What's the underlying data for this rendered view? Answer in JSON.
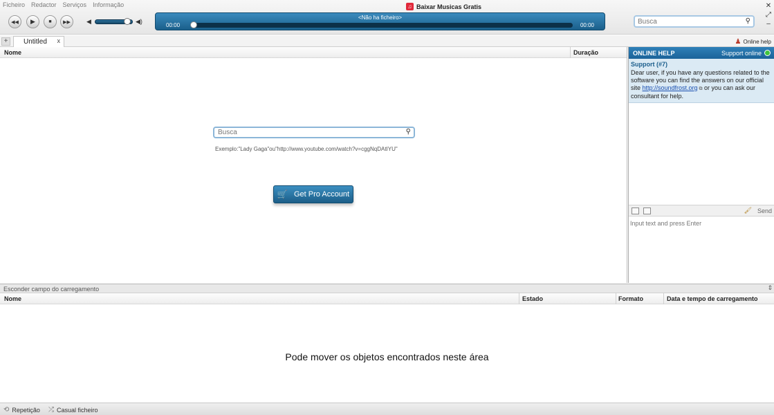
{
  "menu": [
    "Ficheiro",
    "Redactor",
    "Serviços",
    "Informação"
  ],
  "app_title": "Baixar Musicas Gratis",
  "player": {
    "track_title": "<Não ha ficheiro>",
    "time_elapsed": "00:00",
    "time_total": "00:00",
    "volume_level": 0.85,
    "progress": 0
  },
  "top_search": {
    "placeholder": "Busca"
  },
  "tabs": [
    {
      "label": "Untitled",
      "close": "x"
    }
  ],
  "online_help_link": "Online help",
  "main_list": {
    "columns": [
      "Nome",
      "Duração"
    ],
    "search_placeholder": "Busca",
    "example": "Exemplo:\"Lady Gaga\"ou\"http://www.youtube.com/watch?v=cggNqDAtIYU\"",
    "get_pro_label": "Get Pro Account"
  },
  "help_panel": {
    "title": "ONLINE HELP",
    "status": "Support online",
    "support_id": "Support (#7)",
    "message_before": "Dear user, if you have any questions related to the software you can find the answers on our official site ",
    "link": "http://soundfrost.org",
    "message_after": " or you can ask our consultant for help.",
    "send_label": "Send",
    "input_placeholder": "Input text and press Enter"
  },
  "downloads": {
    "hide_label": "Esconder campo do carregamento",
    "columns": [
      "Nome",
      "Estado",
      "Formato",
      "Data e tempo de carregamento"
    ],
    "drop_hint": "Pode mover os objetos encontrados neste área"
  },
  "status_bar": {
    "repeat": "Repetição",
    "shuffle": "Casual ficheiro"
  },
  "colors": {
    "accent": "#1b6399",
    "online": "#3ec43e",
    "app_logo": "#e0283a"
  },
  "icons": [
    "rewind-icon",
    "play-icon",
    "stop-icon",
    "fast-forward-icon",
    "volume-icon",
    "search-icon",
    "cart-icon",
    "repeat-icon",
    "shuffle-icon"
  ]
}
